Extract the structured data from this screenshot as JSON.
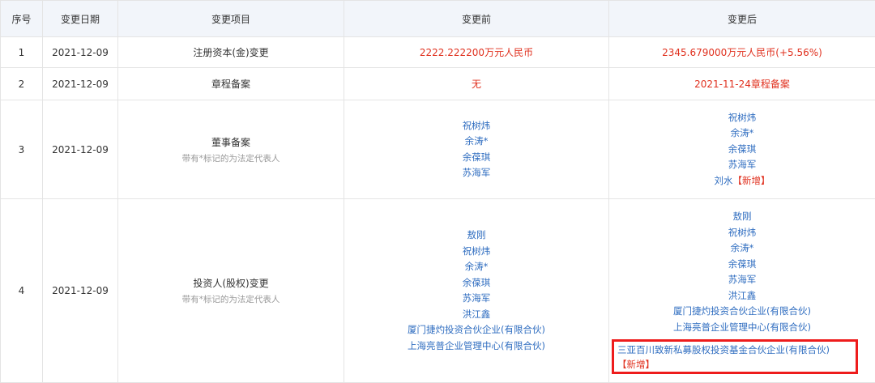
{
  "headers": {
    "seq": "序号",
    "date": "变更日期",
    "item": "变更项目",
    "before": "变更前",
    "after": "变更后"
  },
  "rows": [
    {
      "seq": "1",
      "date": "2021-12-09",
      "item": "注册资本(金)变更",
      "note": "",
      "before_text": "2222.222200万元人民币",
      "after_text": "2345.679000万元人民币(+5.56%)"
    },
    {
      "seq": "2",
      "date": "2021-12-09",
      "item": "章程备案",
      "note": "",
      "before_text": "无",
      "after_text": "2021-11-24章程备案"
    },
    {
      "seq": "3",
      "date": "2021-12-09",
      "item": "董事备案",
      "note": "带有*标记的为法定代表人",
      "before_list": [
        "祝树炜",
        "余涛*",
        "余葆琪",
        "苏海军"
      ],
      "after_list": [
        "祝树炜",
        "余涛*",
        "余葆琪",
        "苏海军"
      ],
      "after_new_name": "刘水",
      "new_tag": "【新增】"
    },
    {
      "seq": "4",
      "date": "2021-12-09",
      "item": "投资人(股权)变更",
      "note": "带有*标记的为法定代表人",
      "before_list": [
        "敖刚",
        "祝树炜",
        "余涛*",
        "余葆琪",
        "苏海军",
        "洪江鑫",
        "厦门捷灼投资合伙企业(有限合伙)",
        "上海亮普企业管理中心(有限合伙)"
      ],
      "after_list": [
        "敖刚",
        "祝树炜",
        "余涛*",
        "余葆琪",
        "苏海军",
        "洪江鑫",
        "厦门捷灼投资合伙企业(有限合伙)",
        "上海亮普企业管理中心(有限合伙)"
      ],
      "after_new_name": "三亚百川致新私募股权投资基金合伙企业(有限合伙)",
      "new_tag": "【新增】"
    }
  ],
  "colors": {
    "header_bg": "#f2f5fa",
    "border": "#e4e4e4",
    "value_red": "#e0301e",
    "link_blue": "#2f6dc0",
    "highlight_red": "#ee1c1c"
  }
}
